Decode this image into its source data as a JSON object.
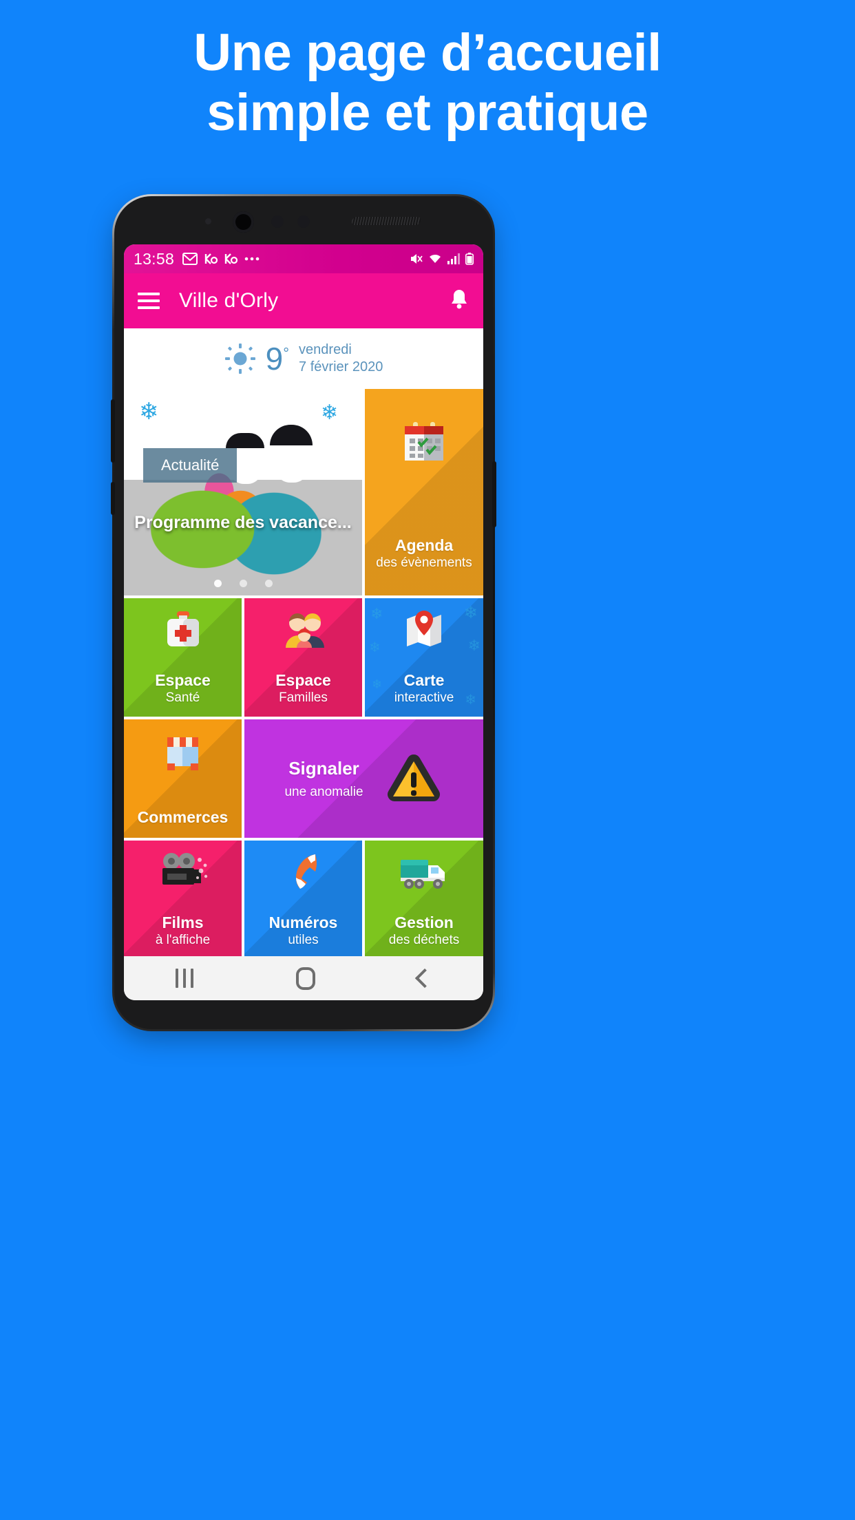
{
  "promo": {
    "line1": "Une page d’accueil",
    "line2": "simple et pratique",
    "background_color": "#1084FB",
    "text_color": "#FFFFFF"
  },
  "phone": {
    "statusbar": {
      "time": "13:58",
      "left_icons": [
        "gmail-icon",
        "app-icon",
        "app-icon",
        "more-icon"
      ],
      "right_icons": [
        "mute-icon",
        "wifi-icon",
        "signal-icon",
        "battery-icon"
      ],
      "background_color": "#D2008E"
    },
    "appbar": {
      "menu_icon": "hamburger-icon",
      "title": "Ville d'Orly",
      "notification_icon": "bell-icon",
      "background_color": "#F20D92"
    },
    "weather": {
      "icon": "sun-icon",
      "temperature": "9",
      "degree": "°",
      "day": "vendredi",
      "date": "7 février 2020",
      "text_color": "#5B93BC"
    },
    "news_carousel": {
      "badge": "Actualité",
      "title": "Programme des vacance...",
      "dots": 3,
      "active_dot": 0
    },
    "tiles": [
      {
        "title": "Agenda",
        "subtitle": "des évènements",
        "color": "#F5A41E",
        "icon": "calendar-icon"
      },
      {
        "title": "Espace",
        "subtitle": "Santé",
        "color": "#7DC51E",
        "icon": "first-aid-kit-icon"
      },
      {
        "title": "Espace",
        "subtitle": "Familles",
        "color": "#F5206B",
        "icon": "family-icon"
      },
      {
        "title": "Carte",
        "subtitle": "interactive",
        "color": "#1E88F0",
        "icon": "map-pin-icon"
      },
      {
        "title": "Commerces",
        "subtitle": "",
        "color": "#F59B12",
        "icon": "shop-icon"
      },
      {
        "title": "Signaler",
        "subtitle": "une anomalie",
        "color": "#C033E0",
        "icon": "warning-icon"
      },
      {
        "title": "Films",
        "subtitle": "à l'affiche",
        "color": "#F5206B",
        "icon": "movie-camera-icon"
      },
      {
        "title": "Numéros",
        "subtitle": "utiles",
        "color": "#1E8BF5",
        "icon": "phone-icon"
      },
      {
        "title": "Gestion",
        "subtitle": "des déchets",
        "color": "#7DC51E",
        "icon": "garbage-truck-icon"
      }
    ],
    "partial_tiles": [
      {
        "color": "#C033E0",
        "icon": "photos-icon"
      },
      {
        "color": "#F59B12",
        "icon": "hook-icon"
      },
      {
        "color": "#F5206B",
        "icon": "briefcase-icon"
      }
    ],
    "navbar": {
      "recents_label": "recents-icon",
      "home_label": "home-icon",
      "back_label": "back-icon"
    }
  }
}
